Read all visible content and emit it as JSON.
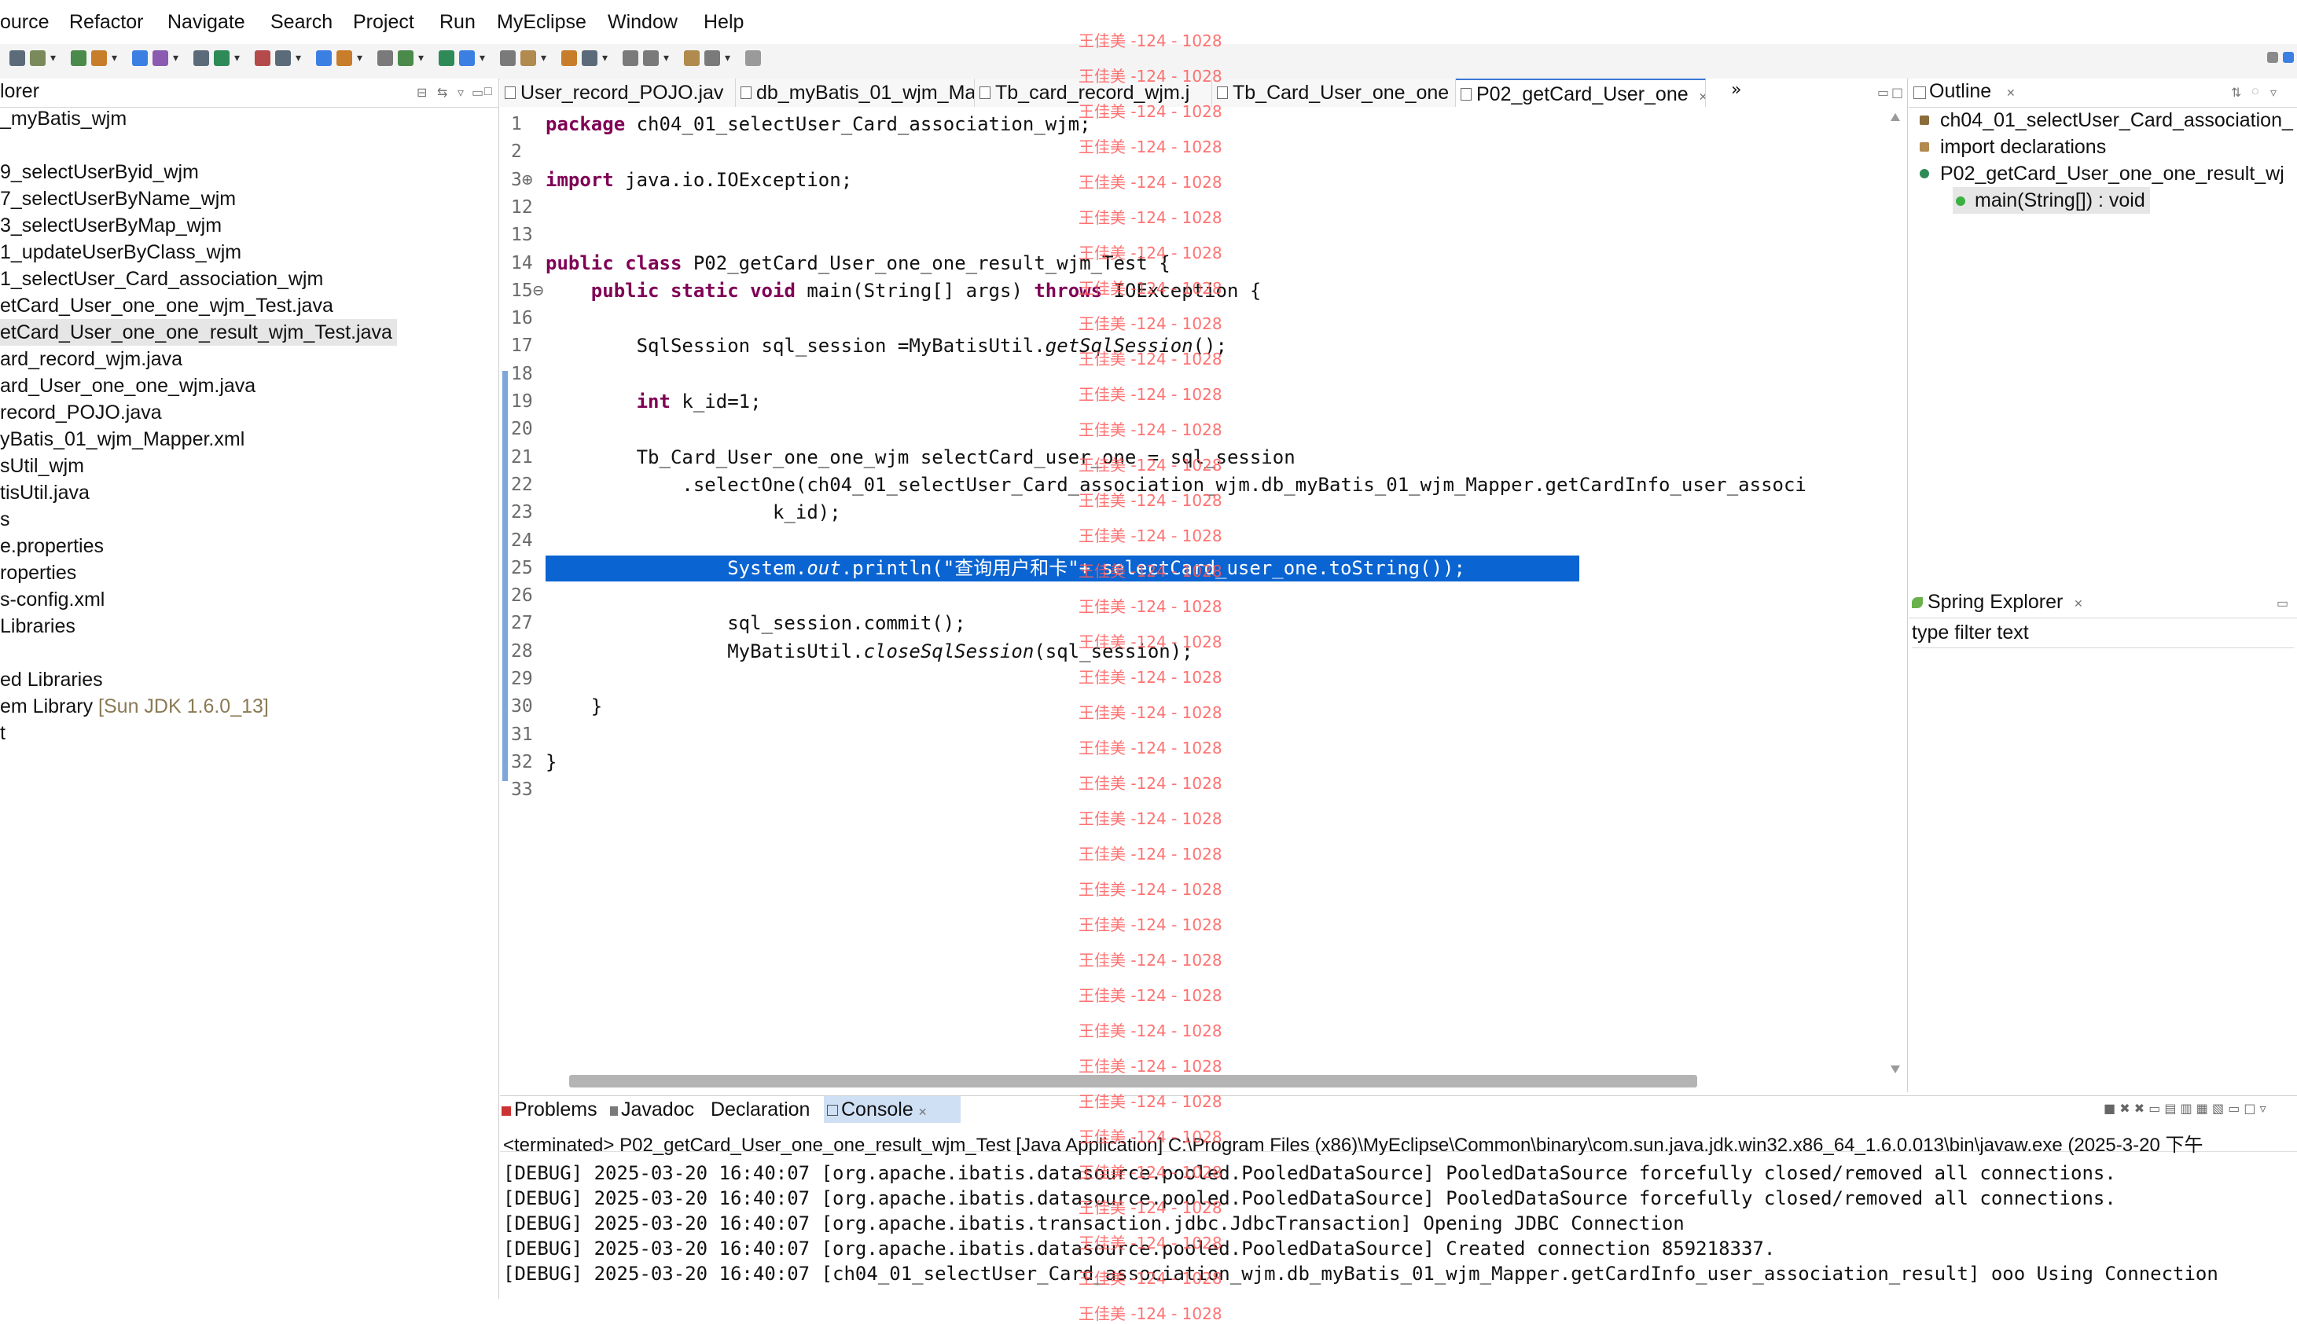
{
  "menubar": {
    "items": [
      "ource",
      "Refactor",
      "Navigate",
      "Search",
      "Project",
      "Run",
      "MyEclipse",
      "Window",
      "Help"
    ]
  },
  "explorer": {
    "title": "lorer",
    "items": [
      {
        "label": "_myBatis_wjm"
      },
      {
        "label": "9_selectUserByid_wjm"
      },
      {
        "label": "7_selectUserByName_wjm"
      },
      {
        "label": "3_selectUserByMap_wjm"
      },
      {
        "label": "1_updateUserByClass_wjm"
      },
      {
        "label": "1_selectUser_Card_association_wjm"
      },
      {
        "label": "etCard_User_one_one_wjm_Test.java"
      },
      {
        "label": "etCard_User_one_one_result_wjm_Test.java"
      },
      {
        "label": "ard_record_wjm.java"
      },
      {
        "label": "ard_User_one_one_wjm.java"
      },
      {
        "label": "record_POJO.java"
      },
      {
        "label": "yBatis_01_wjm_Mapper.xml"
      },
      {
        "label": "sUtil_wjm"
      },
      {
        "label": "tisUtil.java"
      },
      {
        "label": "s"
      },
      {
        "label": "e.properties"
      },
      {
        "label": "roperties"
      },
      {
        "label": "s-config.xml"
      },
      {
        "label": "Libraries"
      },
      {
        "label": "ed Libraries"
      },
      {
        "label": "em Library",
        "note": "[Sun JDK 1.6.0_13]"
      },
      {
        "label": "t"
      }
    ]
  },
  "editor": {
    "tabs": [
      {
        "label": "User_record_POJO.jav"
      },
      {
        "label": "db_myBatis_01_wjm_Ma"
      },
      {
        "label": "Tb_card_record_wjm.j"
      },
      {
        "label": "Tb_Card_User_one_one"
      },
      {
        "label": "P02_getCard_User_one"
      }
    ],
    "overflow": "»",
    "lines": [
      {
        "n": "1",
        "t": "package ch04_01_selectUser_Card_association_wjm;"
      },
      {
        "n": "2",
        "t": ""
      },
      {
        "n": "3⊕",
        "t": "import java.io.IOException;"
      },
      {
        "n": "12",
        "t": ""
      },
      {
        "n": "13",
        "t": ""
      },
      {
        "n": "14",
        "t": "public class P02_getCard_User_one_one_result_wjm_Test {"
      },
      {
        "n": "15⊖",
        "t": "    public static void main(String[] args) throws IOException {"
      },
      {
        "n": "16",
        "t": ""
      },
      {
        "n": "17",
        "t": "        SqlSession sql_session =MyBatisUtil.getSqlSession();"
      },
      {
        "n": "18",
        "t": ""
      },
      {
        "n": "19",
        "t": "        int k_id=1;"
      },
      {
        "n": "20",
        "t": ""
      },
      {
        "n": "21",
        "t": "        Tb_Card_User_one_one_wjm selectCard_user_one = sql_session"
      },
      {
        "n": "22",
        "t": "            .selectOne(\"ch04_01_selectUser_Card_association_wjm.db_myBatis_01_wjm_Mapper.getCardInfo_user_associ"
      },
      {
        "n": "23",
        "t": "                    k_id);"
      },
      {
        "n": "24",
        "t": ""
      },
      {
        "n": "25",
        "t": "                System.out.println(\"查询用户和卡\"+ selectCard_user_one.toString());"
      },
      {
        "n": "26",
        "t": ""
      },
      {
        "n": "27",
        "t": "                sql_session.commit();"
      },
      {
        "n": "28",
        "t": "                MyBatisUtil.closeSqlSession(sql_session);"
      },
      {
        "n": "29",
        "t": ""
      },
      {
        "n": "30",
        "t": "    }"
      },
      {
        "n": "31",
        "t": ""
      },
      {
        "n": "32",
        "t": "}"
      },
      {
        "n": "33",
        "t": ""
      }
    ]
  },
  "outline": {
    "title": "Outline",
    "items": [
      {
        "label": "ch04_01_selectUser_Card_association_"
      },
      {
        "label": "import declarations"
      },
      {
        "label": "P02_getCard_User_one_one_result_wj"
      },
      {
        "label": "main(String[]) : void"
      }
    ]
  },
  "spring": {
    "title": "Spring Explorer",
    "filter": "type filter text"
  },
  "console": {
    "tabs": [
      "Problems",
      "Javadoc",
      "Declaration",
      "Console"
    ],
    "terminated": "<terminated> P02_getCard_User_one_one_result_wjm_Test [Java Application] C:\\Program Files (x86)\\MyEclipse\\Common\\binary\\com.sun.java.jdk.win32.x86_64_1.6.0.013\\bin\\javaw.exe (2025-3-20 下午",
    "lines": [
      "[DEBUG] 2025-03-20 16:40:07 [org.apache.ibatis.datasource.pooled.PooledDataSource] PooledDataSource forcefully closed/removed all connections.",
      "[DEBUG] 2025-03-20 16:40:07 [org.apache.ibatis.datasource.pooled.PooledDataSource] PooledDataSource forcefully closed/removed all connections.",
      "[DEBUG] 2025-03-20 16:40:07 [org.apache.ibatis.transaction.jdbc.JdbcTransaction] Opening JDBC Connection",
      "[DEBUG] 2025-03-20 16:40:07 [org.apache.ibatis.datasource.pooled.PooledDataSource] Created connection 859218337.",
      "[DEBUG] 2025-03-20 16:40:07 [ch04_01_selectUser_Card_association_wjm.db_myBatis_01_wjm_Mapper.getCardInfo_user_association_result] ooo Using Connection"
    ]
  },
  "watermark": {
    "text": "王佳美 -124 - 1028"
  },
  "colors": {
    "keyword": "#7f0055",
    "string": "#2a00ff",
    "selection": "#0a64d2",
    "watermark": "#ff5a5a"
  },
  "icons": [
    "toolbar-icons",
    "close-icon",
    "minimize-icon",
    "maximize-icon",
    "bird-logo-icon",
    "java-file-icon",
    "package-icon",
    "method-icon"
  ]
}
